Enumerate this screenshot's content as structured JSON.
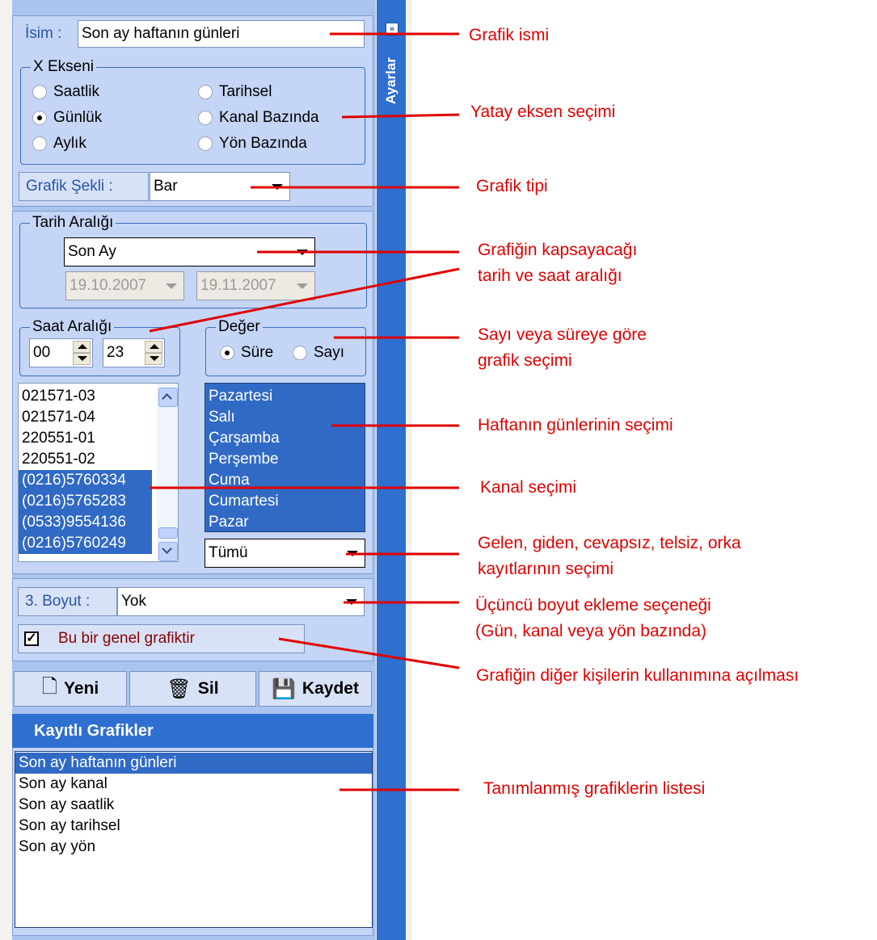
{
  "sidebar": {
    "title": "Ayarlar",
    "expander": "»"
  },
  "name_row": {
    "label": "İsim :",
    "value": "Son ay haftanın günleri"
  },
  "x_axis": {
    "legend": "X Ekseni",
    "options": [
      "Saatlik",
      "Günlük",
      "Aylık",
      "Tarihsel",
      "Kanal Bazında",
      "Yön Bazında"
    ],
    "selected": "Günlük"
  },
  "chart_shape": {
    "label": "Grafik Şekli :",
    "value": "Bar"
  },
  "date_range": {
    "legend": "Tarih Aralığı",
    "preset": "Son Ay",
    "start": "19.10.2007",
    "end": "19.11.2007"
  },
  "hour_range": {
    "legend": "Saat Aralığı",
    "from": "00",
    "to": "23"
  },
  "value_type": {
    "legend": "Değer",
    "options": [
      "Süre",
      "Sayı"
    ],
    "selected": "Süre"
  },
  "channels": {
    "items": [
      "021571-03",
      "021571-04",
      "220551-01",
      "220551-02",
      "(0216)5760334",
      "(0216)5765283",
      "(0533)9554136",
      "(0216)5760249"
    ],
    "selected": [
      "(0216)5760334",
      "(0216)5765283",
      "(0533)9554136",
      "(0216)5760249"
    ]
  },
  "weekdays": {
    "items": [
      "Pazartesi",
      "Salı",
      "Çarşamba",
      "Perşembe",
      "Cuma",
      "Cumartesi",
      "Pazar"
    ]
  },
  "record_filter": {
    "value": "Tümü"
  },
  "third_dim": {
    "label": "3. Boyut :",
    "value": "Yok"
  },
  "general_chart": {
    "label": "Bu bir genel grafiktir",
    "checked": true
  },
  "buttons": {
    "new": "Yeni",
    "delete": "Sil",
    "save": "Kaydet"
  },
  "saved": {
    "title": "Kayıtlı Grafikler",
    "items": [
      "Son ay haftanın günleri",
      "Son ay kanal",
      "Son ay saatlik",
      "Son ay tarihsel",
      "Son ay yön"
    ],
    "selected": "Son ay haftanın günleri"
  },
  "callouts": {
    "c1": "Grafik ismi",
    "c2": "Yatay eksen seçimi",
    "c3": "Grafik tipi",
    "c4a": "Grafiğin kapsayacağı",
    "c4b": "tarih ve saat aralığı",
    "c5a": "Sayı veya süreye göre",
    "c5b": "grafik seçimi",
    "c6": "Haftanın günlerinin seçimi",
    "c7": "Kanal seçimi",
    "c8a": "Gelen, giden, cevapsız, telsiz, orka",
    "c8b": "kayıtlarının seçimi",
    "c9a": "Üçüncü boyut ekleme seçeneği",
    "c9b": "(Gün, kanal veya yön bazında)",
    "c10": "Grafiğin diğer kişilerin kullanımına açılması",
    "c11": "Tanımlanmış grafiklerin listesi"
  },
  "colors": {
    "accent": "#2e6fd0",
    "selection": "#316ac5",
    "callout": "#e00000"
  }
}
